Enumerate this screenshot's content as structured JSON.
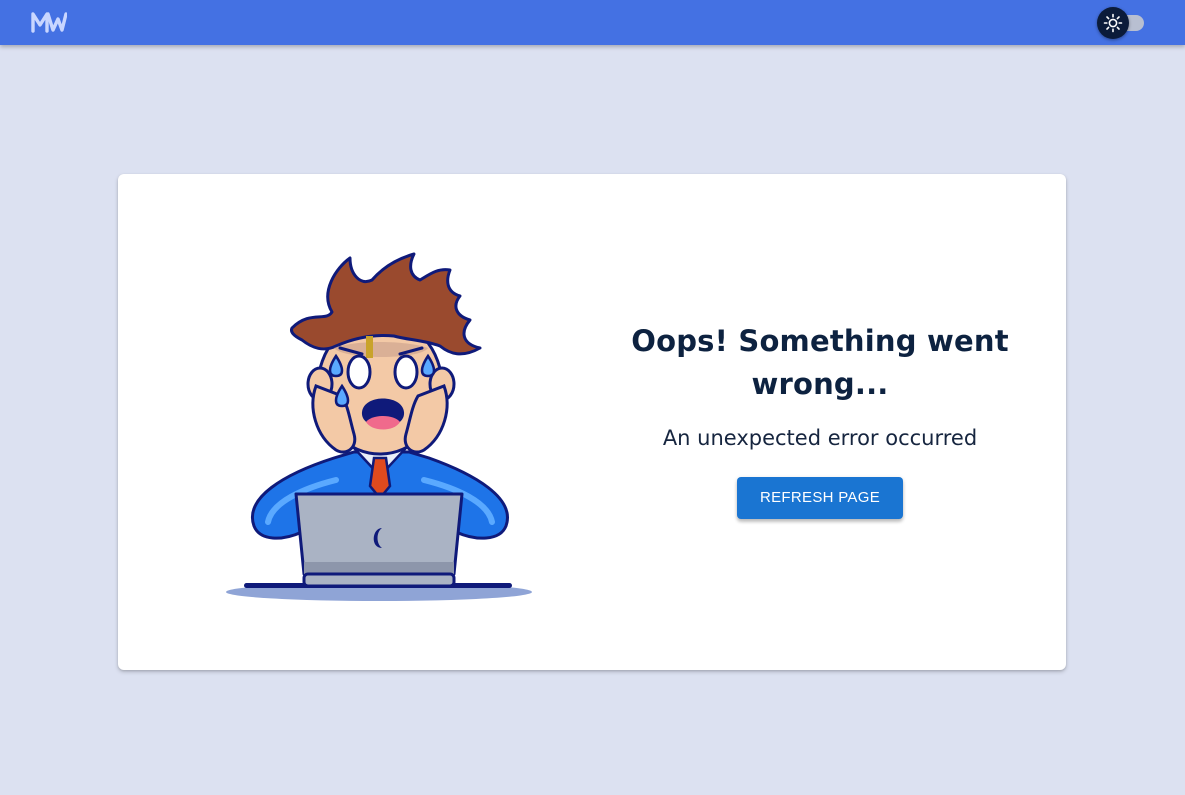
{
  "header": {
    "logo_icon": "mw-logo-icon",
    "theme_toggle_icon": "sun-icon",
    "colors": {
      "bar": "#4471e3",
      "toggle_thumb": "#0b1b3a"
    }
  },
  "error": {
    "title": "Oops! Something went wrong...",
    "message": "An unexpected error occurred",
    "refresh_label": "REFRESH PAGE",
    "illustration_icon": "stressed-man-laptop-illustration"
  },
  "colors": {
    "page_bg": "#dce1f1",
    "card_bg": "#ffffff",
    "button": "#1a75d2",
    "text": "#0d2240"
  }
}
